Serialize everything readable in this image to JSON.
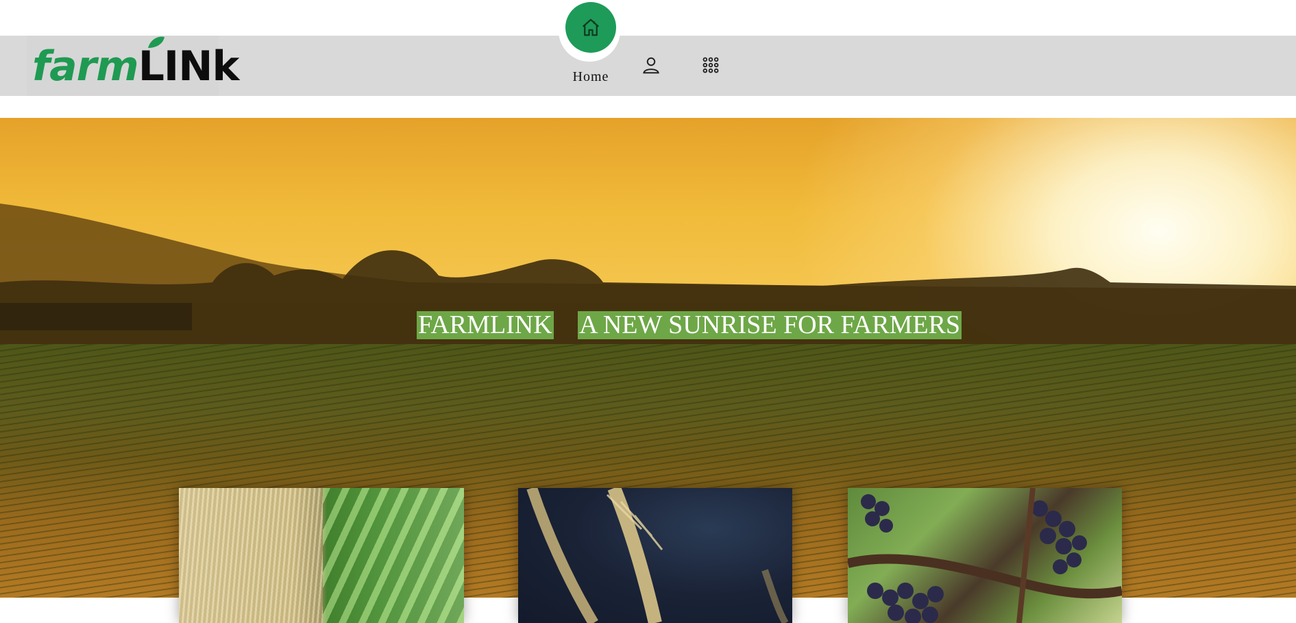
{
  "header": {
    "logo": {
      "part1": "farm",
      "part2": "LINk"
    },
    "nav": {
      "home_label": "Home",
      "home_icon": "home-icon",
      "profile_icon": "user-icon",
      "apps_icon": "grid-icon"
    }
  },
  "hero": {
    "title_left": "FARMLINK",
    "title_right": "A NEW SUNRISE FOR FARMERS"
  },
  "colors": {
    "accent_green": "#1e9b58",
    "hero_label_bg": "#6ea747",
    "nav_bg": "#d9d9d9"
  }
}
